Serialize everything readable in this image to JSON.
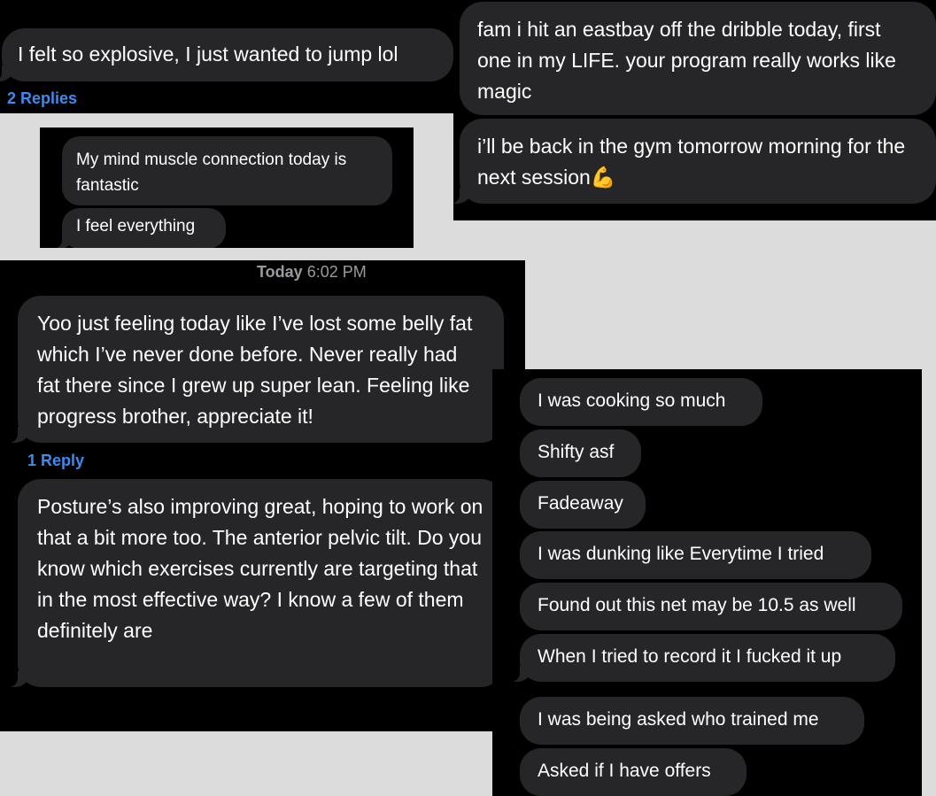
{
  "panel1": {
    "message": "I felt so explosive, I just wanted to jump lol",
    "replies": "2 Replies"
  },
  "panel2": {
    "messages": [
      "My mind muscle connection today is fantastic",
      "I feel everything"
    ]
  },
  "panel3": {
    "messages": [
      "fam i hit an eastbay off the dribble today, first one in my LIFE. your program really works like magic",
      "i’ll be back in the gym tomorrow morning for the next session"
    ],
    "emoji": "💪"
  },
  "panel4": {
    "timestamp_day": "Today",
    "timestamp_time": "6:02 PM",
    "message1": "Yoo just feeling today like I’ve lost some belly fat which I’ve never done before. Never really had fat there since I grew up super lean. Feeling like progress brother, appreciate it!",
    "replies": "1 Reply",
    "message2": "Posture’s also improving great, hoping to work on that a bit more too. The anterior pelvic tilt. Do you know which exercises currently are targeting that in the most effective way? I know a few of them definitely are"
  },
  "panel5": {
    "messages": [
      "I was cooking so much",
      "Shifty asf",
      "Fadeaway",
      "I was dunking like Everytime I tried",
      "Found out this net may be 10.5 as well",
      "When I tried to record it I fucked it up",
      "I was being asked who trained me",
      "Asked if I have offers"
    ]
  },
  "colors": {
    "bubble": "#262628",
    "panel_bg": "#000000",
    "page_bg": "#dcdcdc",
    "link": "#3b8bf0",
    "timestamp": "#9a9a9e"
  }
}
